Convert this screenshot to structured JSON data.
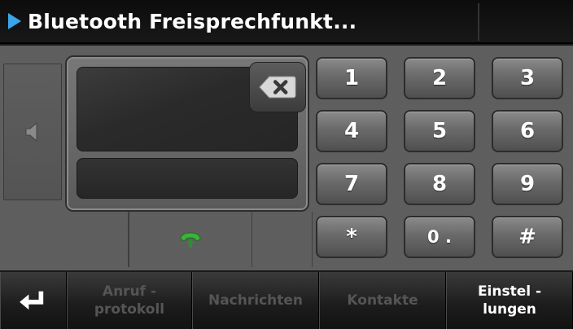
{
  "title": "Bluetooth Freisprechfunkt...",
  "icons": {
    "title_arrow": "play-triangle-icon",
    "speaker": "speaker-icon",
    "backspace": "backspace-icon",
    "call": "phone-call-icon",
    "back": "return-arrow-icon"
  },
  "colors": {
    "accent": "#3aa6e8",
    "call_green": "#3bb33b"
  },
  "keypad": {
    "k1": "1",
    "k2": "2",
    "k3": "3",
    "k4": "4",
    "k5": "5",
    "k6": "6",
    "k7": "7",
    "k8": "8",
    "k9": "9",
    "kstar": "*",
    "k0": "0 .",
    "khash": "#"
  },
  "nav": {
    "anruf_l1": "Anruf -",
    "anruf_l2": "protokoll",
    "nachrichten": "Nachrichten",
    "kontakte": "Kontakte",
    "einst_l1": "Einstel -",
    "einst_l2": "lungen"
  }
}
